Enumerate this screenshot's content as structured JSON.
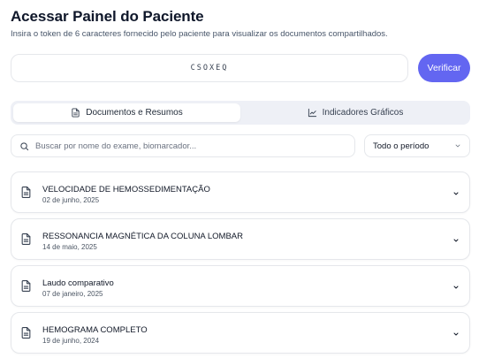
{
  "header": {
    "title": "Acessar Painel do Paciente",
    "subtitle": "Insira o token de 6 caracteres fornecido pelo paciente para visualizar os documentos compartilhados."
  },
  "token": {
    "value": "CSOXEQ",
    "button_label": "Verificar"
  },
  "tabs": [
    {
      "label": "Documentos e Resumos",
      "icon": "file-text-icon",
      "active": true
    },
    {
      "label": "Indicadores Gráficos",
      "icon": "line-chart-icon",
      "active": false
    }
  ],
  "filters": {
    "search_placeholder": "Buscar por nome do exame, biomarcador...",
    "period_selected": "Todo o período"
  },
  "documents": [
    {
      "title": "VELOCIDADE DE HEMOSSEDIMENTAÇÃO",
      "date": "02 de junho, 2025"
    },
    {
      "title": "RESSONANCIA MAGNÉTICA DA COLUNA LOMBAR",
      "date": "14 de maio, 2025"
    },
    {
      "title": "Laudo comparativo",
      "date": "07 de janeiro, 2025"
    },
    {
      "title": "HEMOGRAMA COMPLETO",
      "date": "19 de junho, 2024"
    }
  ],
  "colors": {
    "accent": "#6366f1",
    "tab_bg": "#eef0f6",
    "border": "#e5e7eb"
  }
}
